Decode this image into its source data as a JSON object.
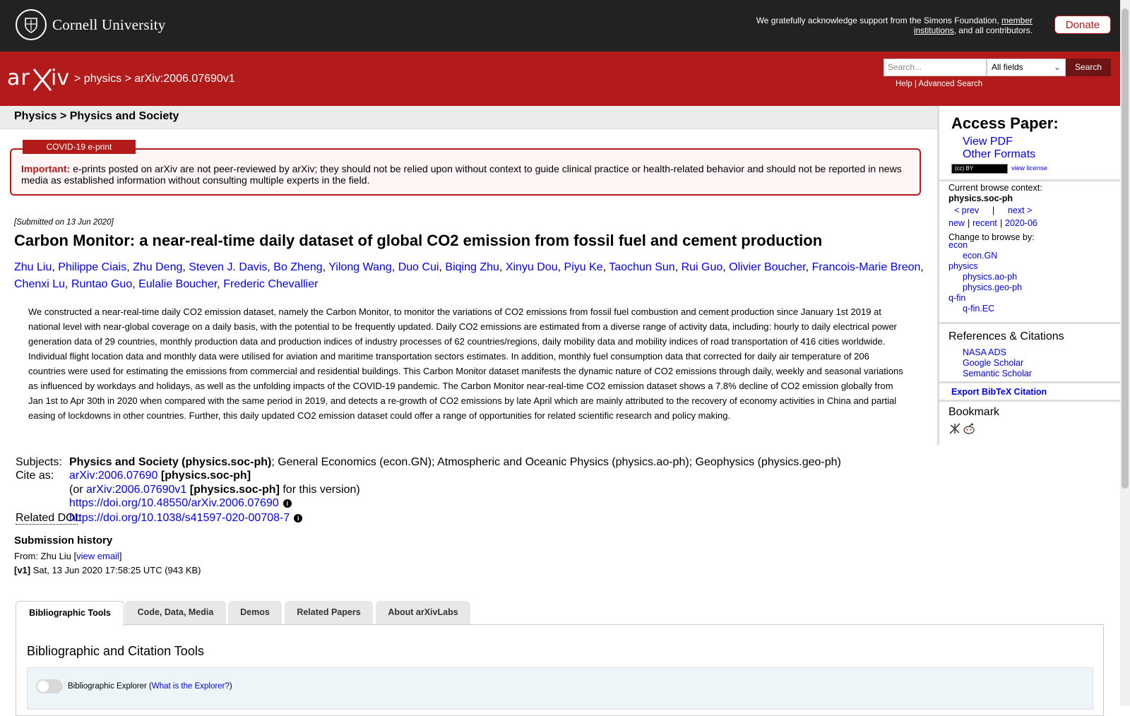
{
  "cornell": {
    "name": "Cornell University",
    "support_pre": "We gratefully acknowledge support from the Simons Foundation, ",
    "support_link": "member institutions",
    "support_post": ", and all contributors.",
    "donate": "Donate"
  },
  "arxiv": {
    "logo": "arXiv",
    "breadcrumb": "> physics > arXiv:2006.07690v1"
  },
  "search": {
    "placeholder": "Search...",
    "field_selected": "All fields",
    "button": "Search",
    "help": "Help",
    "separator": "|",
    "advanced": "Advanced Search"
  },
  "subheader": "Physics > Physics and Society",
  "covid": {
    "tag": "COVID-19 e-print",
    "important_label": "Important:",
    "text": " e-prints posted on arXiv are not peer-reviewed by arXiv; they should not be relied upon without context to guide clinical practice or health-related behavior and should not be reported in news media as established information without consulting multiple experts in the field."
  },
  "paper": {
    "submitted": "[Submitted on 13 Jun 2020]",
    "title": "Carbon Monitor: a near-real-time daily dataset of global CO2 emission from fossil fuel and cement production",
    "authors": [
      "Zhu Liu",
      "Philippe Ciais",
      "Zhu Deng",
      "Steven J. Davis",
      "Bo Zheng",
      "Yilong Wang",
      "Duo Cui",
      "Biqing Zhu",
      "Xinyu Dou",
      "Piyu Ke",
      "Taochun Sun",
      "Rui Guo",
      "Olivier Boucher",
      "Francois-Marie Breon",
      "Chenxi Lu",
      "Runtao Guo",
      "Eulalie Boucher",
      "Frederic Chevallier"
    ],
    "abstract": "We constructed a near-real-time daily CO2 emission dataset, namely the Carbon Monitor, to monitor the variations of CO2 emissions from fossil fuel combustion and cement production since January 1st 2019 at national level with near-global coverage on a daily basis, with the potential to be frequently updated. Daily CO2 emissions are estimated from a diverse range of activity data, including: hourly to daily electrical power generation data of 29 countries, monthly production data and production indices of industry processes of 62 countries/regions, daily mobility data and mobility indices of road transportation of 416 cities worldwide. Individual flight location data and monthly data were utilised for aviation and maritime transportation sectors estimates. In addition, monthly fuel consumption data that corrected for daily air temperature of 206 countries were used for estimating the emissions from commercial and residential buildings. This Carbon Monitor dataset manifests the dynamic nature of CO2 emissions through daily, weekly and seasonal variations as influenced by workdays and holidays, as well as the unfolding impacts of the COVID-19 pandemic. The Carbon Monitor near-real-time CO2 emission dataset shows a 7.8% decline of CO2 emission globally from Jan 1st to Apr 30th in 2020 when compared with the same period in 2019, and detects a re-growth of CO2 emissions by late April which are mainly attributed to the recovery of economy activities in China and partial easing of lockdowns in other countries. Further, this daily updated CO2 emission dataset could offer a range of opportunities for related scientific research and policy making."
  },
  "meta": {
    "subjects_label": "Subjects:",
    "subjects_primary": "Physics and Society (physics.soc-ph)",
    "subjects_rest": "; General Economics (econ.GN); Atmospheric and Oceanic Physics (physics.ao-ph); Geophysics (physics.geo-ph)",
    "cite_label": "Cite as:",
    "cite_id": "arXiv:2006.07690",
    "cite_cat": " [physics.soc-ph]",
    "or_pre": "(or ",
    "or_id": "arXiv:2006.07690v1",
    "or_cat": " [physics.soc-ph]",
    "or_post": " for this version)",
    "doi": "https://doi.org/10.48550/arXiv.2006.07690",
    "related_label": "Related DOI",
    "related_colon": ":",
    "related_doi": "https://doi.org/10.1038/s41597-020-00708-7",
    "info": "i"
  },
  "history": {
    "title": "Submission history",
    "from_pre": "From: Zhu Liu [",
    "view_email": "view email",
    "from_post": "]",
    "v1_label": "[v1]",
    "v1_text": " Sat, 13 Jun 2020 17:58:25 UTC (943 KB)"
  },
  "tabs": [
    "Bibliographic Tools",
    "Code, Data, Media",
    "Demos",
    "Related Papers",
    "About arXivLabs"
  ],
  "panel": {
    "title": "Bibliographic and Citation Tools",
    "explorer_label": "Bibliographic Explorer (",
    "explorer_link": "What is the Explorer?",
    "explorer_post": ")"
  },
  "sidebar": {
    "access_title": "Access Paper:",
    "view_pdf": "View PDF",
    "other_formats": "Other Formats",
    "license_badge": "(cc) BY",
    "view_license": "view license",
    "browse_context_label": "Current browse context:",
    "browse_context": "physics.soc-ph",
    "prev": "< prev",
    "sep": "|",
    "next": "next >",
    "new": "new",
    "recent": "recent",
    "month": "2020-06",
    "change_browse": "Change to browse by:",
    "browse": [
      {
        "label": "econ",
        "indent": false
      },
      {
        "label": "econ.GN",
        "indent": true
      },
      {
        "label": "physics",
        "indent": false
      },
      {
        "label": "physics.ao-ph",
        "indent": true
      },
      {
        "label": "physics.geo-ph",
        "indent": true
      },
      {
        "label": "q-fin",
        "indent": false
      },
      {
        "label": "q-fin.EC",
        "indent": true
      }
    ],
    "refs_title": "References & Citations",
    "refs": [
      "NASA ADS",
      "Google Scholar",
      "Semantic Scholar"
    ],
    "export_bibtex": "Export BibTeX Citation",
    "bookmark_title": "Bookmark"
  }
}
